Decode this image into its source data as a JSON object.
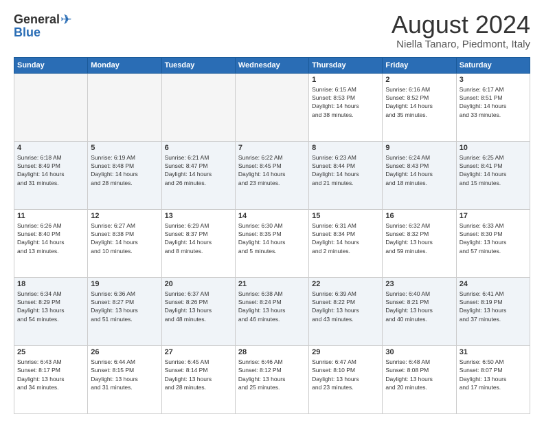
{
  "header": {
    "logo_general": "General",
    "logo_blue": "Blue",
    "month_title": "August 2024",
    "location": "Niella Tanaro, Piedmont, Italy"
  },
  "weekdays": [
    "Sunday",
    "Monday",
    "Tuesday",
    "Wednesday",
    "Thursday",
    "Friday",
    "Saturday"
  ],
  "weeks": [
    [
      {
        "day": "",
        "info": ""
      },
      {
        "day": "",
        "info": ""
      },
      {
        "day": "",
        "info": ""
      },
      {
        "day": "",
        "info": ""
      },
      {
        "day": "1",
        "info": "Sunrise: 6:15 AM\nSunset: 8:53 PM\nDaylight: 14 hours\nand 38 minutes."
      },
      {
        "day": "2",
        "info": "Sunrise: 6:16 AM\nSunset: 8:52 PM\nDaylight: 14 hours\nand 35 minutes."
      },
      {
        "day": "3",
        "info": "Sunrise: 6:17 AM\nSunset: 8:51 PM\nDaylight: 14 hours\nand 33 minutes."
      }
    ],
    [
      {
        "day": "4",
        "info": "Sunrise: 6:18 AM\nSunset: 8:49 PM\nDaylight: 14 hours\nand 31 minutes."
      },
      {
        "day": "5",
        "info": "Sunrise: 6:19 AM\nSunset: 8:48 PM\nDaylight: 14 hours\nand 28 minutes."
      },
      {
        "day": "6",
        "info": "Sunrise: 6:21 AM\nSunset: 8:47 PM\nDaylight: 14 hours\nand 26 minutes."
      },
      {
        "day": "7",
        "info": "Sunrise: 6:22 AM\nSunset: 8:45 PM\nDaylight: 14 hours\nand 23 minutes."
      },
      {
        "day": "8",
        "info": "Sunrise: 6:23 AM\nSunset: 8:44 PM\nDaylight: 14 hours\nand 21 minutes."
      },
      {
        "day": "9",
        "info": "Sunrise: 6:24 AM\nSunset: 8:43 PM\nDaylight: 14 hours\nand 18 minutes."
      },
      {
        "day": "10",
        "info": "Sunrise: 6:25 AM\nSunset: 8:41 PM\nDaylight: 14 hours\nand 15 minutes."
      }
    ],
    [
      {
        "day": "11",
        "info": "Sunrise: 6:26 AM\nSunset: 8:40 PM\nDaylight: 14 hours\nand 13 minutes."
      },
      {
        "day": "12",
        "info": "Sunrise: 6:27 AM\nSunset: 8:38 PM\nDaylight: 14 hours\nand 10 minutes."
      },
      {
        "day": "13",
        "info": "Sunrise: 6:29 AM\nSunset: 8:37 PM\nDaylight: 14 hours\nand 8 minutes."
      },
      {
        "day": "14",
        "info": "Sunrise: 6:30 AM\nSunset: 8:35 PM\nDaylight: 14 hours\nand 5 minutes."
      },
      {
        "day": "15",
        "info": "Sunrise: 6:31 AM\nSunset: 8:34 PM\nDaylight: 14 hours\nand 2 minutes."
      },
      {
        "day": "16",
        "info": "Sunrise: 6:32 AM\nSunset: 8:32 PM\nDaylight: 13 hours\nand 59 minutes."
      },
      {
        "day": "17",
        "info": "Sunrise: 6:33 AM\nSunset: 8:30 PM\nDaylight: 13 hours\nand 57 minutes."
      }
    ],
    [
      {
        "day": "18",
        "info": "Sunrise: 6:34 AM\nSunset: 8:29 PM\nDaylight: 13 hours\nand 54 minutes."
      },
      {
        "day": "19",
        "info": "Sunrise: 6:36 AM\nSunset: 8:27 PM\nDaylight: 13 hours\nand 51 minutes."
      },
      {
        "day": "20",
        "info": "Sunrise: 6:37 AM\nSunset: 8:26 PM\nDaylight: 13 hours\nand 48 minutes."
      },
      {
        "day": "21",
        "info": "Sunrise: 6:38 AM\nSunset: 8:24 PM\nDaylight: 13 hours\nand 46 minutes."
      },
      {
        "day": "22",
        "info": "Sunrise: 6:39 AM\nSunset: 8:22 PM\nDaylight: 13 hours\nand 43 minutes."
      },
      {
        "day": "23",
        "info": "Sunrise: 6:40 AM\nSunset: 8:21 PM\nDaylight: 13 hours\nand 40 minutes."
      },
      {
        "day": "24",
        "info": "Sunrise: 6:41 AM\nSunset: 8:19 PM\nDaylight: 13 hours\nand 37 minutes."
      }
    ],
    [
      {
        "day": "25",
        "info": "Sunrise: 6:43 AM\nSunset: 8:17 PM\nDaylight: 13 hours\nand 34 minutes."
      },
      {
        "day": "26",
        "info": "Sunrise: 6:44 AM\nSunset: 8:15 PM\nDaylight: 13 hours\nand 31 minutes."
      },
      {
        "day": "27",
        "info": "Sunrise: 6:45 AM\nSunset: 8:14 PM\nDaylight: 13 hours\nand 28 minutes."
      },
      {
        "day": "28",
        "info": "Sunrise: 6:46 AM\nSunset: 8:12 PM\nDaylight: 13 hours\nand 25 minutes."
      },
      {
        "day": "29",
        "info": "Sunrise: 6:47 AM\nSunset: 8:10 PM\nDaylight: 13 hours\nand 23 minutes."
      },
      {
        "day": "30",
        "info": "Sunrise: 6:48 AM\nSunset: 8:08 PM\nDaylight: 13 hours\nand 20 minutes."
      },
      {
        "day": "31",
        "info": "Sunrise: 6:50 AM\nSunset: 8:07 PM\nDaylight: 13 hours\nand 17 minutes."
      }
    ]
  ]
}
